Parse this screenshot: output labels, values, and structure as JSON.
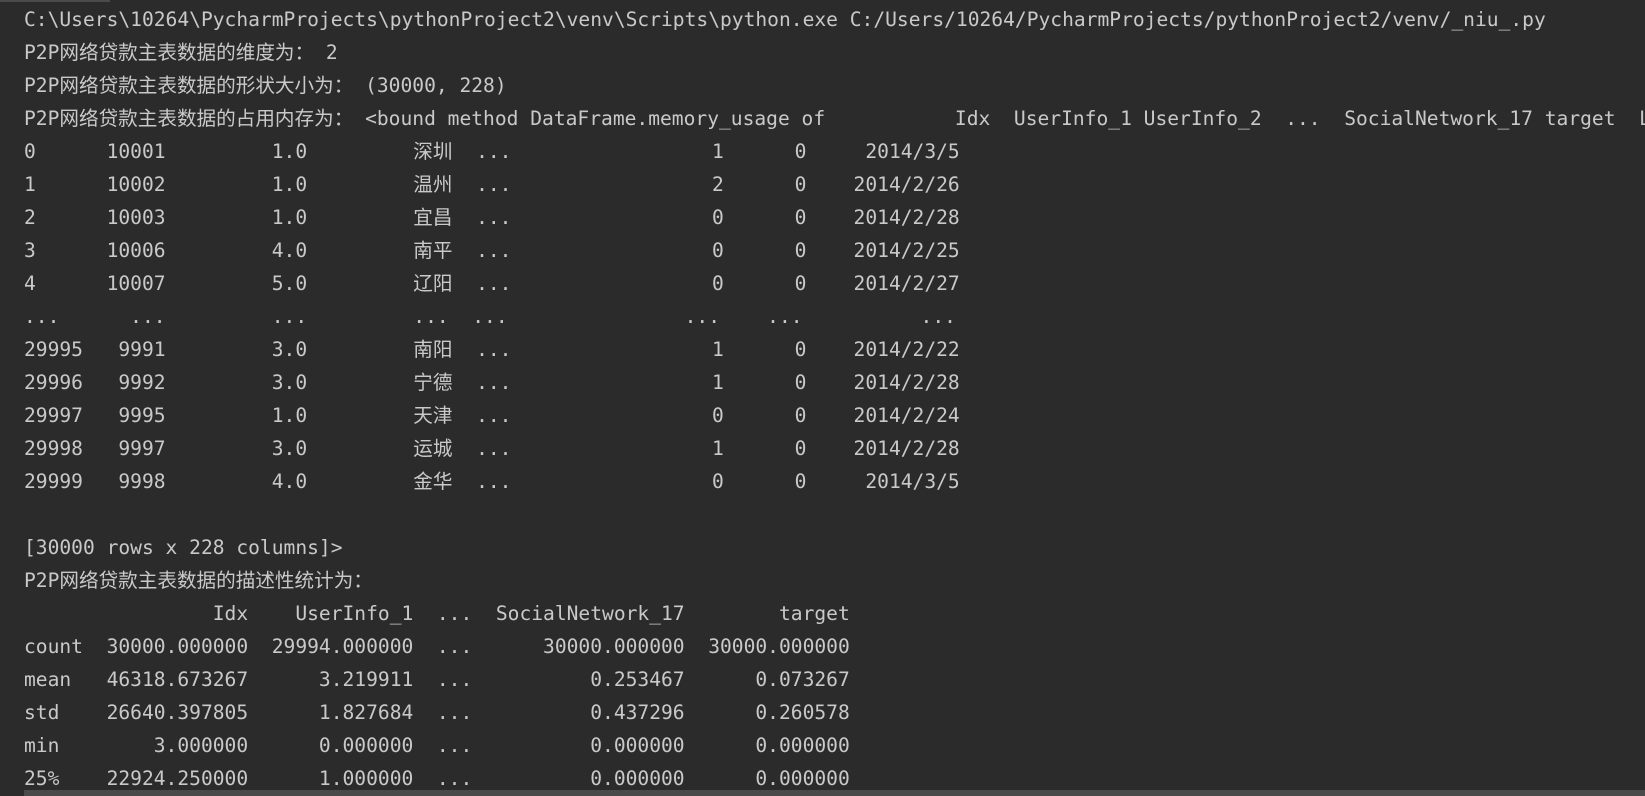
{
  "console": {
    "lines": [
      "C:\\Users\\10264\\PycharmProjects\\pythonProject2\\venv\\Scripts\\python.exe C:/Users/10264/PycharmProjects/pythonProject2/venv/_niu_.py",
      "P2P网络贷款主表数据的维度为： 2",
      "P2P网络贷款主表数据的形状大小为： (30000, 228)",
      "P2P网络贷款主表数据的占用内存为： <bound method DataFrame.memory_usage of           Idx  UserInfo_1 UserInfo_2  ...  SocialNetwork_17 target  L",
      "0      10001         1.0         深圳  ...                 1      0     2014/3/5",
      "1      10002         1.0         温州  ...                 2      0    2014/2/26",
      "2      10003         1.0         宜昌  ...                 0      0    2014/2/28",
      "3      10006         4.0         南平  ...                 0      0    2014/2/25",
      "4      10007         5.0         辽阳  ...                 0      0    2014/2/27",
      "...      ...         ...         ...  ...               ...    ...          ...",
      "29995   9991         3.0         南阳  ...                 1      0    2014/2/22",
      "29996   9992         3.0         宁德  ...                 1      0    2014/2/28",
      "29997   9995         1.0         天津  ...                 0      0    2014/2/24",
      "29998   9997         3.0         运城  ...                 1      0    2014/2/28",
      "29999   9998         4.0         金华  ...                 0      0     2014/3/5",
      "",
      "[30000 rows x 228 columns]>",
      "P2P网络贷款主表数据的描述性统计为：",
      "                Idx    UserInfo_1  ...  SocialNetwork_17        target",
      "count  30000.000000  29994.000000  ...      30000.000000  30000.000000",
      "mean   46318.673267      3.219911  ...          0.253467      0.073267",
      "std    26640.397805      1.827684  ...          0.437296      0.260578",
      "min        3.000000      0.000000  ...          0.000000      0.000000",
      "25%    22924.250000      1.000000  ...          0.000000      0.000000"
    ]
  },
  "colors": {
    "background": "#2b2b2b",
    "text": "#c9c9c9"
  }
}
